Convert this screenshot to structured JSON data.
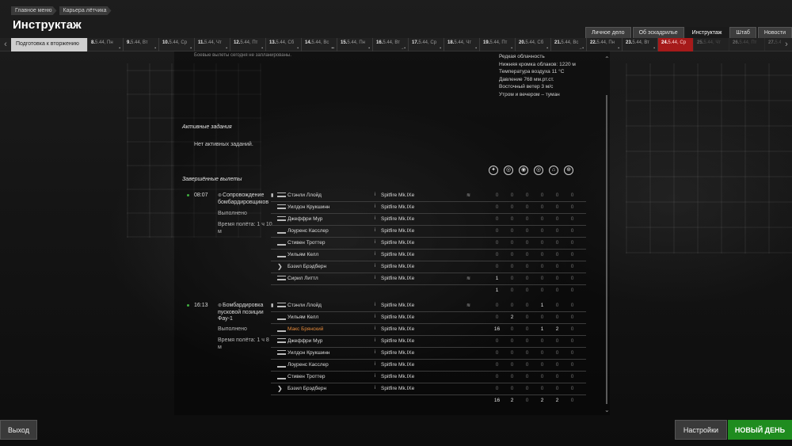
{
  "breadcrumbs": [
    "Главное меню",
    "Карьера лётчика"
  ],
  "page_title": "Инструктаж",
  "tabs": [
    {
      "label": "Личное дело",
      "active": false
    },
    {
      "label": "Об эскадрилье",
      "active": false
    },
    {
      "label": "Инструктаж",
      "active": true
    },
    {
      "label": "Штаб",
      "active": false
    },
    {
      "label": "Новости",
      "active": false
    }
  ],
  "timeline": {
    "left_arrow": "‹",
    "right_arrow": "›",
    "first_label": "Подготовка к вторжению",
    "days": [
      {
        "num": "8.",
        "rest": "5.44, Пн",
        "mark": "▪"
      },
      {
        "num": "9.",
        "rest": "5.44, Вт",
        "mark": "▪"
      },
      {
        "num": "10.",
        "rest": "5.44, Ср",
        "mark": "▪"
      },
      {
        "num": "11.",
        "rest": "5.44, Чт",
        "mark": "▪"
      },
      {
        "num": "12.",
        "rest": "5.44, Пт",
        "mark": "▪"
      },
      {
        "num": "13.",
        "rest": "5.44, Сб",
        "mark": "▪"
      },
      {
        "num": "14.",
        "rest": "5.44, Вс",
        "mark": "▪▪"
      },
      {
        "num": "15.",
        "rest": "5.44, Пн",
        "mark": "▪"
      },
      {
        "num": "16.",
        "rest": "5.44, Вт",
        "mark": "→▪"
      },
      {
        "num": "17.",
        "rest": "5.44, Ср",
        "mark": "▪"
      },
      {
        "num": "18.",
        "rest": "5.44, Чт",
        "mark": "▪"
      },
      {
        "num": "19.",
        "rest": "5.44, Пт",
        "mark": "▪"
      },
      {
        "num": "20.",
        "rest": "5.44, Сб",
        "mark": "▪"
      },
      {
        "num": "21.",
        "rest": "5.44, Вс",
        "mark": "→▪"
      },
      {
        "num": "22.",
        "rest": "5.44, Пн",
        "mark": "▪"
      },
      {
        "num": "23.",
        "rest": "5.44, Вт",
        "mark": "▪"
      },
      {
        "num": "24.",
        "rest": "5.44, Ср",
        "mark": "",
        "today": true
      },
      {
        "num": "25.",
        "rest": "5.44, Чт",
        "mark": "",
        "future": true
      },
      {
        "num": "26.",
        "rest": "5.44, Пт",
        "mark": "",
        "future": true
      },
      {
        "num": "27.",
        "rest": "5.44, Сб",
        "mark": "",
        "future": true
      }
    ]
  },
  "truncated_text": "Боевые вылеты сегодня не запланированы.",
  "weather": [
    "Редкая облачность",
    "Нижняя кромка облаков: 1220 м",
    "Температура воздуха 11 °C",
    "Давление 768 мм.рт.ст.",
    "Восточный ветер 3 м/с",
    "Утром и вечером – туман"
  ],
  "active_tasks_title": "Активные задания",
  "no_tasks_text": "Нет активных заданий.",
  "completed_title": "Завершённые вылеты",
  "stat_icons": [
    "aircraft-kills-icon",
    "ground-kills-icon",
    "vehicle-kills-icon",
    "naval-kills-icon",
    "artillery-kills-icon",
    "aa-kills-icon"
  ],
  "stat_icon_glyphs": [
    "✦",
    "◎",
    "◉",
    "◎",
    "⌂",
    "⊕"
  ],
  "scroll": {
    "up": "⌃",
    "down": "⌄"
  },
  "missions": [
    {
      "time": "08:07",
      "title": "Сопровождение бомбардировщиков",
      "status": "Выполнено",
      "flight_time": "Время полёта: 1 ч 10 м",
      "crew": [
        {
          "name": "Стэнли Ллойд",
          "plane": "Spitfire Mk.IXe",
          "rank": "stripes",
          "leader": true,
          "ctrl": true,
          "stats": [
            0,
            0,
            0,
            0,
            0,
            0
          ]
        },
        {
          "name": "Уилдон Крукшинн",
          "plane": "Spitfire Mk.IXe",
          "rank": "stripes",
          "stats": [
            0,
            0,
            0,
            0,
            0,
            0
          ]
        },
        {
          "name": "Джеффри Мур",
          "plane": "Spitfire Mk.IXe",
          "rank": "stripes",
          "stats": [
            0,
            0,
            0,
            0,
            0,
            0
          ]
        },
        {
          "name": "Лоуренс Касслер",
          "plane": "Spitfire Mk.IXe",
          "rank": "bar",
          "stats": [
            0,
            0,
            0,
            0,
            0,
            0
          ]
        },
        {
          "name": "Стивен Троттер",
          "plane": "Spitfire Mk.IXe",
          "rank": "bar",
          "stats": [
            0,
            0,
            0,
            0,
            0,
            0
          ]
        },
        {
          "name": "Уильям Келл",
          "plane": "Spitfire Mk.IXe",
          "rank": "bar",
          "stats": [
            0,
            0,
            0,
            0,
            0,
            0
          ]
        },
        {
          "name": "Бэзил Брэдберн",
          "plane": "Spitfire Mk.IXe",
          "rank": "chev",
          "stats": [
            0,
            0,
            0,
            0,
            0,
            0
          ]
        },
        {
          "name": "Сирил Литтл",
          "plane": "Spitfire Mk.IXe",
          "rank": "stripes",
          "ctrl": true,
          "stats": [
            1,
            0,
            0,
            0,
            0,
            0
          ]
        }
      ],
      "totals": [
        1,
        0,
        0,
        0,
        0,
        0
      ]
    },
    {
      "time": "16:13",
      "title": "Бомбардировка пусковой позиции Фау-1",
      "status": "Выполнено",
      "flight_time": "Время полёта: 1 ч 8 м",
      "crew": [
        {
          "name": "Стэнли Ллойд",
          "plane": "Spitfire Mk.IXe",
          "rank": "stripes",
          "leader": true,
          "ctrl": true,
          "stats": [
            0,
            0,
            0,
            1,
            0,
            0
          ]
        },
        {
          "name": "Уильям Келл",
          "plane": "Spitfire Mk.IXe",
          "rank": "bar",
          "stats": [
            0,
            2,
            0,
            0,
            0,
            0
          ]
        },
        {
          "name": "Макс Брянский",
          "plane": "Spitfire Mk.IXe",
          "rank": "bar",
          "highlight": true,
          "stats": [
            16,
            0,
            0,
            1,
            2,
            0
          ]
        },
        {
          "name": "Джеффри Мур",
          "plane": "Spitfire Mk.IXe",
          "rank": "stripes",
          "stats": [
            0,
            0,
            0,
            0,
            0,
            0
          ]
        },
        {
          "name": "Уилдон Крукшинн",
          "plane": "Spitfire Mk.IXe",
          "rank": "stripes",
          "stats": [
            0,
            0,
            0,
            0,
            0,
            0
          ]
        },
        {
          "name": "Лоуренс Касслер",
          "plane": "Spitfire Mk.IXe",
          "rank": "bar",
          "stats": [
            0,
            0,
            0,
            0,
            0,
            0
          ]
        },
        {
          "name": "Стивен Троттер",
          "plane": "Spitfire Mk.IXe",
          "rank": "bar",
          "stats": [
            0,
            0,
            0,
            0,
            0,
            0
          ]
        },
        {
          "name": "Бэзил Брэдберн",
          "plane": "Spitfire Mk.IXe",
          "rank": "chev",
          "stats": [
            0,
            0,
            0,
            0,
            0,
            0
          ]
        }
      ],
      "totals": [
        16,
        2,
        0,
        2,
        2,
        0
      ]
    }
  ],
  "buttons": {
    "exit": "Выход",
    "settings": "Настройки",
    "new_day": "НОВЫЙ ДЕНЬ"
  },
  "colors": {
    "today": "#a61a1a",
    "new_day": "#1f8c1f",
    "highlight_name": "#e48a3c"
  }
}
